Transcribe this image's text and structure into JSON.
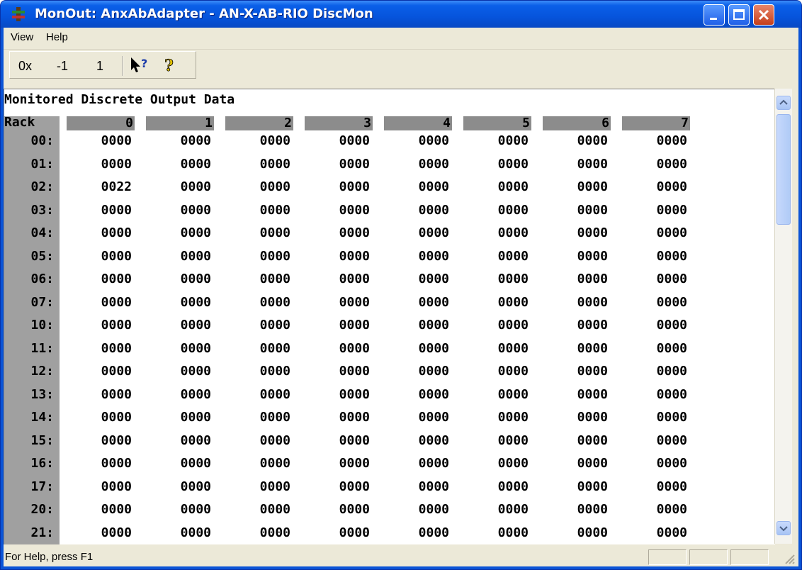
{
  "window": {
    "title": "MonOut: AnxAbAdapter - AN-X-AB-RIO DiscMon",
    "icon": "app-icon",
    "titlebar_color": "#0654dc"
  },
  "menu": [
    "View",
    "Help"
  ],
  "toolbar": {
    "hex_label": "0x",
    "minus_label": "-1",
    "plus_label": "1",
    "context_help_icon": "context-help-icon",
    "help_icon": "help-icon"
  },
  "data": {
    "heading": "Monitored Discrete Output Data",
    "rack_label": "Rack",
    "columns": [
      "0",
      "1",
      "2",
      "3",
      "4",
      "5",
      "6",
      "7"
    ],
    "rows": [
      {
        "rack": "00:",
        "values": [
          "0000",
          "0000",
          "0000",
          "0000",
          "0000",
          "0000",
          "0000",
          "0000"
        ]
      },
      {
        "rack": "01:",
        "values": [
          "0000",
          "0000",
          "0000",
          "0000",
          "0000",
          "0000",
          "0000",
          "0000"
        ]
      },
      {
        "rack": "02:",
        "values": [
          "0022",
          "0000",
          "0000",
          "0000",
          "0000",
          "0000",
          "0000",
          "0000"
        ]
      },
      {
        "rack": "03:",
        "values": [
          "0000",
          "0000",
          "0000",
          "0000",
          "0000",
          "0000",
          "0000",
          "0000"
        ]
      },
      {
        "rack": "04:",
        "values": [
          "0000",
          "0000",
          "0000",
          "0000",
          "0000",
          "0000",
          "0000",
          "0000"
        ]
      },
      {
        "rack": "05:",
        "values": [
          "0000",
          "0000",
          "0000",
          "0000",
          "0000",
          "0000",
          "0000",
          "0000"
        ]
      },
      {
        "rack": "06:",
        "values": [
          "0000",
          "0000",
          "0000",
          "0000",
          "0000",
          "0000",
          "0000",
          "0000"
        ]
      },
      {
        "rack": "07:",
        "values": [
          "0000",
          "0000",
          "0000",
          "0000",
          "0000",
          "0000",
          "0000",
          "0000"
        ]
      },
      {
        "rack": "10:",
        "values": [
          "0000",
          "0000",
          "0000",
          "0000",
          "0000",
          "0000",
          "0000",
          "0000"
        ]
      },
      {
        "rack": "11:",
        "values": [
          "0000",
          "0000",
          "0000",
          "0000",
          "0000",
          "0000",
          "0000",
          "0000"
        ]
      },
      {
        "rack": "12:",
        "values": [
          "0000",
          "0000",
          "0000",
          "0000",
          "0000",
          "0000",
          "0000",
          "0000"
        ]
      },
      {
        "rack": "13:",
        "values": [
          "0000",
          "0000",
          "0000",
          "0000",
          "0000",
          "0000",
          "0000",
          "0000"
        ]
      },
      {
        "rack": "14:",
        "values": [
          "0000",
          "0000",
          "0000",
          "0000",
          "0000",
          "0000",
          "0000",
          "0000"
        ]
      },
      {
        "rack": "15:",
        "values": [
          "0000",
          "0000",
          "0000",
          "0000",
          "0000",
          "0000",
          "0000",
          "0000"
        ]
      },
      {
        "rack": "16:",
        "values": [
          "0000",
          "0000",
          "0000",
          "0000",
          "0000",
          "0000",
          "0000",
          "0000"
        ]
      },
      {
        "rack": "17:",
        "values": [
          "0000",
          "0000",
          "0000",
          "0000",
          "0000",
          "0000",
          "0000",
          "0000"
        ]
      },
      {
        "rack": "20:",
        "values": [
          "0000",
          "0000",
          "0000",
          "0000",
          "0000",
          "0000",
          "0000",
          "0000"
        ]
      },
      {
        "rack": "21:",
        "values": [
          "0000",
          "0000",
          "0000",
          "0000",
          "0000",
          "0000",
          "0000",
          "0000"
        ]
      }
    ]
  },
  "status": {
    "text": "For Help, press F1"
  }
}
